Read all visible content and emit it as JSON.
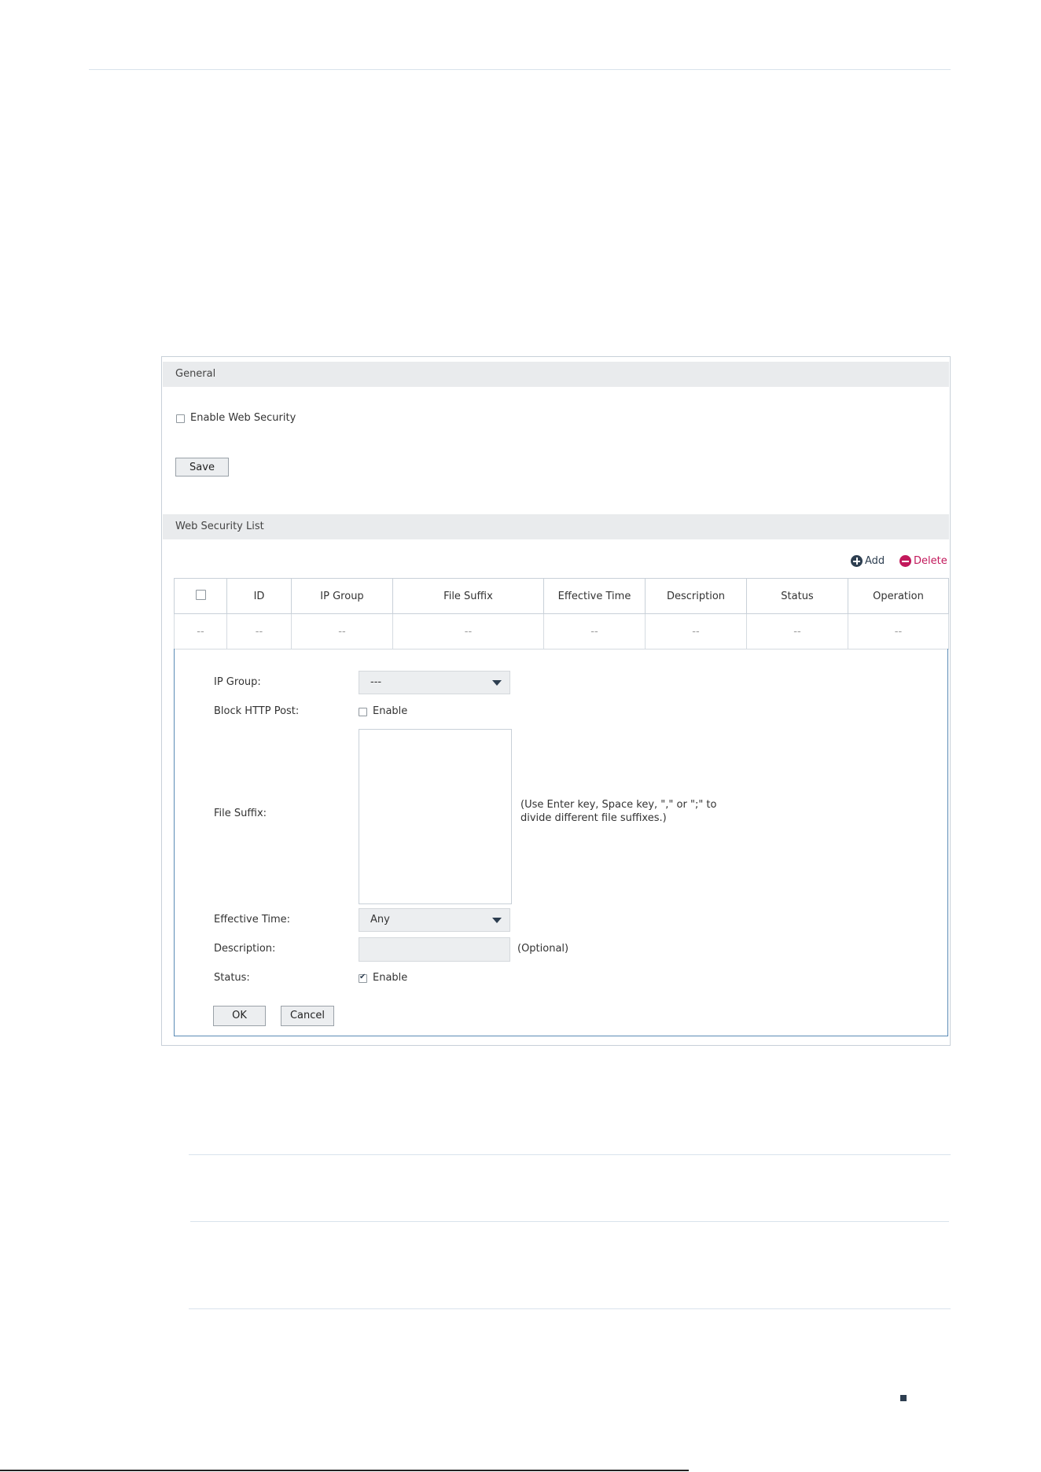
{
  "general": {
    "header": "General",
    "enable_web_security_label": "Enable Web Security",
    "enable_web_security_checked": false,
    "save_label": "Save"
  },
  "list": {
    "header": "Web Security List",
    "add_label": "Add",
    "delete_label": "Delete",
    "columns": [
      "ID",
      "IP Group",
      "File Suffix",
      "Effective Time",
      "Description",
      "Status",
      "Operation"
    ],
    "empty_row": [
      "--",
      "--",
      "--",
      "--",
      "--",
      "--",
      "--",
      "--"
    ]
  },
  "editor": {
    "ip_group_label": "IP Group:",
    "ip_group_value": "---",
    "block_http_post_label": "Block HTTP Post:",
    "block_http_post_option": "Enable",
    "block_http_post_checked": false,
    "file_suffix_label": "File Suffix:",
    "file_suffix_value": "",
    "file_suffix_hint_line1": "(Use Enter key, Space key, \",\" or \";\" to",
    "file_suffix_hint_line2": "divide different file suffixes.)",
    "effective_time_label": "Effective Time:",
    "effective_time_value": "Any",
    "description_label": "Description:",
    "description_value": "",
    "description_hint": "(Optional)",
    "status_label": "Status:",
    "status_option": "Enable",
    "status_checked": true,
    "ok_label": "OK",
    "cancel_label": "Cancel"
  },
  "colors": {
    "accent_dark": "#2d3e50",
    "delete": "#c2185b",
    "edit_border": "#5b8bb5"
  }
}
